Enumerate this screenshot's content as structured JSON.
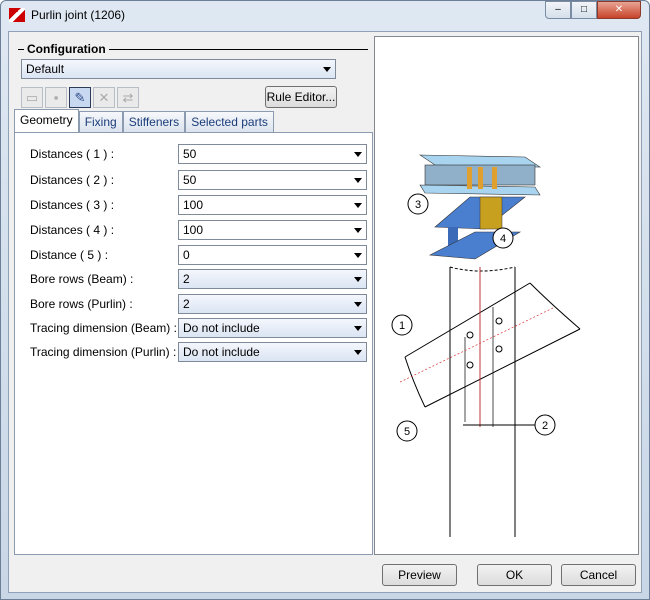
{
  "window": {
    "title": "Purlin joint (1206)",
    "controls": [
      "–",
      "□",
      "✕"
    ]
  },
  "config": {
    "heading": "Configuration",
    "selected": "Default",
    "rule_editor": "Rule Editor...",
    "toolbar": [
      "new-icon",
      "save-icon",
      "save-as-icon",
      "delete-icon",
      "refresh-icon"
    ]
  },
  "tabs": [
    {
      "label": "Geometry",
      "selected": true
    },
    {
      "label": "Fixing"
    },
    {
      "label": "Stiffeners"
    },
    {
      "label": "Selected parts"
    }
  ],
  "fields": [
    {
      "label": "Distances ( 1 ) :",
      "value": "50",
      "style": "white"
    },
    {
      "label": "Distances ( 2 ) :",
      "value": "50",
      "style": "white"
    },
    {
      "label": "Distances ( 3 ) :",
      "value": "100",
      "style": "white"
    },
    {
      "label": "Distances ( 4 ) :",
      "value": "100",
      "style": "white"
    },
    {
      "label": "Distance    ( 5 ) :",
      "value": "0",
      "style": "white"
    },
    {
      "label": "Bore rows (Beam) :",
      "value": "2",
      "style": "blue"
    },
    {
      "label": "Bore rows (Purlin) :",
      "value": "2",
      "style": "blue"
    },
    {
      "label": "Tracing dimension (Beam) :",
      "value": "Do not include",
      "style": "blue"
    },
    {
      "label": "Tracing dimension (Purlin) :",
      "value": "Do not include",
      "style": "blue"
    }
  ],
  "preview": {
    "callouts": [
      "1",
      "2",
      "3",
      "4",
      "5"
    ]
  },
  "buttons": {
    "preview": "Preview",
    "ok": "OK",
    "cancel": "Cancel"
  }
}
